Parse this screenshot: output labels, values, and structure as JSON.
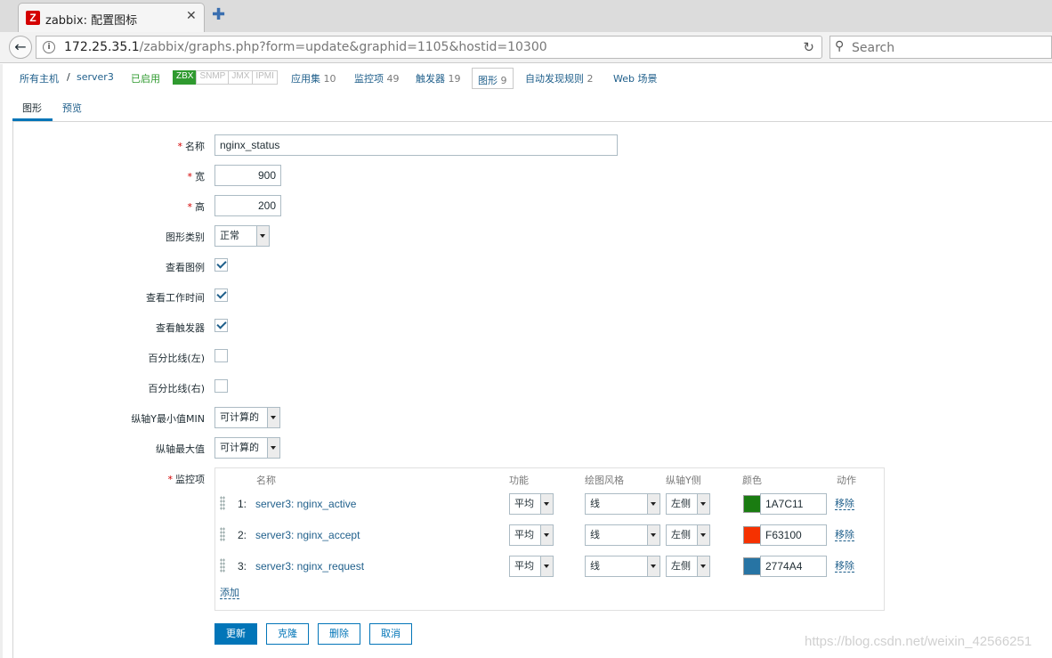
{
  "browser": {
    "tab_title": "zabbix: 配置图标",
    "tab_favicon_letter": "Z",
    "url_host": "172.25.35.1",
    "url_path": "/zabbix/graphs.php?form=update&graphid=1105&hostid=10300",
    "search_placeholder": "Search"
  },
  "hostnav": {
    "all_hosts": "所有主机",
    "separator": "/",
    "host": "server3",
    "status": "已启用",
    "availability": [
      "ZBX",
      "SNMP",
      "JMX",
      "IPMI"
    ],
    "applications": "应用集",
    "applications_count": "10",
    "items": "监控项",
    "items_count": "49",
    "triggers": "触发器",
    "triggers_count": "19",
    "graphs": "图形",
    "graphs_count": "9",
    "discovery": "自动发现规则",
    "discovery_count": "2",
    "web": "Web 场景"
  },
  "subtabs": {
    "graph": "图形",
    "preview": "预览"
  },
  "form": {
    "name_label": "名称",
    "name_value": "nginx_status",
    "width_label": "宽",
    "width_value": "900",
    "height_label": "高",
    "height_value": "200",
    "graph_type_label": "图形类别",
    "graph_type_value": "正常",
    "show_legend_label": "查看图例",
    "show_working_time_label": "查看工作时间",
    "show_triggers_label": "查看触发器",
    "percentile_left_label": "百分比线(左)",
    "percentile_right_label": "百分比线(右)",
    "ymin_label": "纵轴Y最小值MIN",
    "ymin_value": "可计算的",
    "ymax_label": "纵轴最大值",
    "ymax_value": "可计算的",
    "items_label": "监控项",
    "checkboxes": {
      "show_legend": true,
      "show_working_time": true,
      "show_triggers": true,
      "percentile_left": false,
      "percentile_right": false
    }
  },
  "items_table": {
    "headers": {
      "name": "名称",
      "function": "功能",
      "draw_style": "绘图风格",
      "y_axis": "纵轴Y侧",
      "color": "颜色",
      "action": "动作"
    },
    "rows": [
      {
        "num": "1:",
        "name": "server3: nginx_active",
        "function": "平均",
        "draw_style": "线",
        "y_axis": "左侧",
        "color_hex": "1A7C11",
        "action": "移除"
      },
      {
        "num": "2:",
        "name": "server3: nginx_accept",
        "function": "平均",
        "draw_style": "线",
        "y_axis": "左侧",
        "color_hex": "F63100",
        "action": "移除"
      },
      {
        "num": "3:",
        "name": "server3: nginx_request",
        "function": "平均",
        "draw_style": "线",
        "y_axis": "左侧",
        "color_hex": "2774A4",
        "action": "移除"
      }
    ],
    "add_link": "添加"
  },
  "buttons": {
    "update": "更新",
    "clone": "克隆",
    "delete": "删除",
    "cancel": "取消"
  },
  "watermark": "https://blog.csdn.net/weixin_42566251",
  "colors": {
    "accent": "#0275b8",
    "link": "#1f5f8b",
    "required": "#d40000",
    "enabled": "#2f9a2f"
  }
}
